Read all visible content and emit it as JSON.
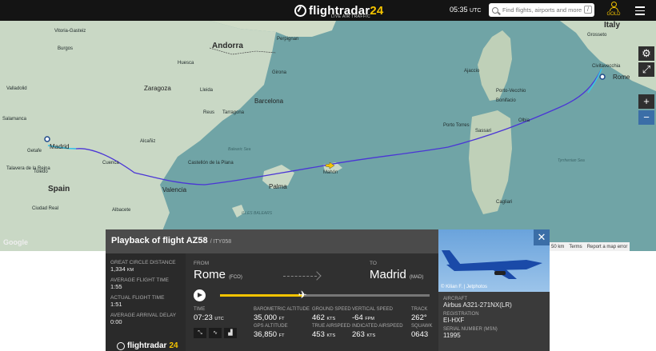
{
  "header": {
    "brand_name": "flightradar",
    "brand_num": "24",
    "brand_tagline": "LIVE AIR TRAFFIC",
    "time": "05:35",
    "time_zone": "UTC",
    "search_placeholder": "Find flights, airports and more",
    "search_shortcut": "/",
    "gold_label": "GOLD"
  },
  "map": {
    "labels": {
      "italy": "Italy",
      "andorra": "Andorra",
      "spain": "Spain",
      "madrid": "Madrid",
      "rome": "Rome",
      "zaragoza": "Zaragoza",
      "barcelona": "Barcelona",
      "valencia": "Valencia",
      "palma": "Palma",
      "vitoria": "Vitoria-Gasteiz",
      "burgos": "Burgos",
      "valladolid": "Valladolid",
      "salamanca": "Salamanca",
      "getafe": "Getafe",
      "toledo": "Toledo",
      "talavera": "Talavera de la Reina",
      "ciudad_real": "Ciudad Real",
      "albacete": "Albacete",
      "castellon": "Castellón de la Plana",
      "tarragona": "Tarragona",
      "lleida": "Lleida",
      "reus": "Reus",
      "girona": "Girona",
      "perpignan": "Perpignan",
      "mahon": "Mahón",
      "ajaccio": "Ajaccio",
      "sassari": "Sassari",
      "cagliari": "Cagliari",
      "porto_torres": "Porto Torres",
      "grosseto": "Grosseto",
      "civitavecchia": "Civitavecchia",
      "olbia": "Olbia",
      "porto_vecchio": "Porto-Vecchio",
      "bonifacio": "Bonifacio",
      "tyrrhenian": "Tyrrhenian Sea",
      "balearic_sea": "Balearic Sea",
      "illes_balears": "ILLES BALEARS",
      "alcaniz": "Alcañiz",
      "huesca": "Huesca",
      "cuenca": "Cuenca"
    },
    "attribution": "Google",
    "scale": "50 km",
    "terms": "Terms",
    "report": "Report a map error",
    "controls": {
      "settings": "⚙",
      "expand": "⤢",
      "zoom_in": "+",
      "zoom_out": "−"
    }
  },
  "panel": {
    "title": "Playback of flight AZ58",
    "subtitle": "/ ITY058",
    "close": "✕",
    "photo_credit": "© Kilian F. | Jetphotos",
    "stats": [
      {
        "label": "GREAT CIRCLE DISTANCE",
        "value": "1,334",
        "unit": "KM"
      },
      {
        "label": "AVERAGE FLIGHT TIME",
        "value": "1:55",
        "unit": ""
      },
      {
        "label": "ACTUAL FLIGHT TIME",
        "value": "1:51",
        "unit": ""
      },
      {
        "label": "AVERAGE ARRIVAL DELAY",
        "value": "0:00",
        "unit": ""
      }
    ],
    "footer_brand": "flightradar",
    "footer_brand_num": "24",
    "route": {
      "from_label": "FROM",
      "from_city": "Rome",
      "from_code": "(FCO)",
      "to_label": "TO",
      "to_city": "Madrid",
      "to_code": "(MAD)",
      "progress": 0.4
    },
    "data": {
      "time_label": "TIME",
      "time_value": "07:23",
      "time_unit": "UTC",
      "baro_label": "BAROMETRIC ALTITUDE",
      "baro_value": "35,000",
      "baro_unit": "FT",
      "gps_label": "GPS ALTITUDE",
      "gps_value": "36,850",
      "gps_unit": "FT",
      "gs_label": "GROUND SPEED",
      "gs_value": "462",
      "gs_unit": "KTS",
      "tas_label": "TRUE AIRSPEED",
      "tas_value": "453",
      "tas_unit": "KTS",
      "vs_label": "VERTICAL SPEED",
      "vs_value": "-64",
      "vs_unit": "FPM",
      "ias_label": "INDICATED AIRSPEED",
      "ias_value": "263",
      "ias_unit": "KTS",
      "track_label": "TRACK",
      "track_value": "262°",
      "squawk_label": "SQUAWK",
      "squawk_value": "0643"
    },
    "aircraft": {
      "type_label": "AIRCRAFT",
      "type_value": "Airbus A321-271NX(LR)",
      "reg_label": "REGISTRATION",
      "reg_value": "EI-HXF",
      "msn_label": "SERIAL NUMBER (MSN)",
      "msn_value": "11995"
    }
  }
}
